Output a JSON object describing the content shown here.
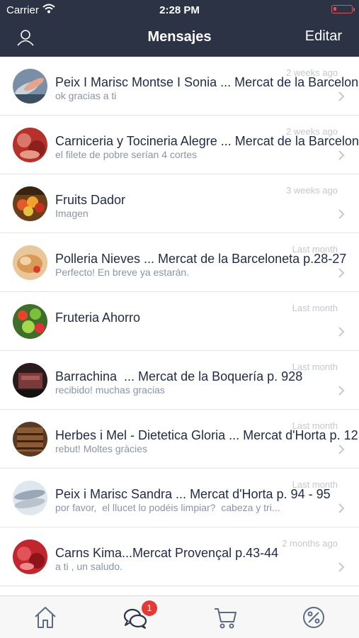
{
  "status_bar": {
    "carrier": "Carrier",
    "time": "2:28 PM"
  },
  "nav": {
    "title": "Mensajes",
    "edit_label": "Editar"
  },
  "messages": [
    {
      "title": "Peix I Marisc Montse I Sonia ... Mercat de la Barceloneta",
      "subtitle": "ok gracias a ti",
      "time": "2 weeks ago"
    },
    {
      "title": "Carniceria y Tocineria Alegre ... Mercat de la Barceloneta",
      "subtitle": "el filete de pobre serían 4 cortes",
      "time": "2 weeks ago"
    },
    {
      "title": "Fruits Dador",
      "subtitle": "Imagen",
      "time": "3 weeks ago"
    },
    {
      "title": "Polleria Nieves ... Mercat de la Barceloneta p.28-27",
      "subtitle": "Perfecto! En breve ya estarán.",
      "time": "Last month"
    },
    {
      "title": "Fruteria Ahorro",
      "subtitle": "",
      "time": "Last month"
    },
    {
      "title": "Barrachina  ... Mercat de la Boquería p. 928",
      "subtitle": "recibido! muchas gracias",
      "time": "Last month"
    },
    {
      "title": "Herbes i Mel - Dietetica Gloria ... Mercat d'Horta p. 12",
      "subtitle": "rebut! Moltes gràcies",
      "time": "Last month"
    },
    {
      "title": "Peix i Marisc Sandra ... Mercat d'Horta p. 94 - 95",
      "subtitle": "por favor,  el llucet lo podéis limpiar?  cabeza y tri...",
      "time": "Last month"
    },
    {
      "title": "Carns Kima...Mercat Provençal p.43-44",
      "subtitle": "a ti , un saludo.",
      "time": "2 months ago"
    }
  ],
  "tabbar": {
    "items": [
      {
        "icon": "home-icon"
      },
      {
        "icon": "chat-icon",
        "badge": "1"
      },
      {
        "icon": "cart-icon"
      },
      {
        "icon": "percent-icon"
      }
    ]
  },
  "colors": {
    "nav_bg": "#2b3344",
    "badge": "#e53935",
    "icon": "#5b6b86",
    "battery": "#e35252"
  }
}
